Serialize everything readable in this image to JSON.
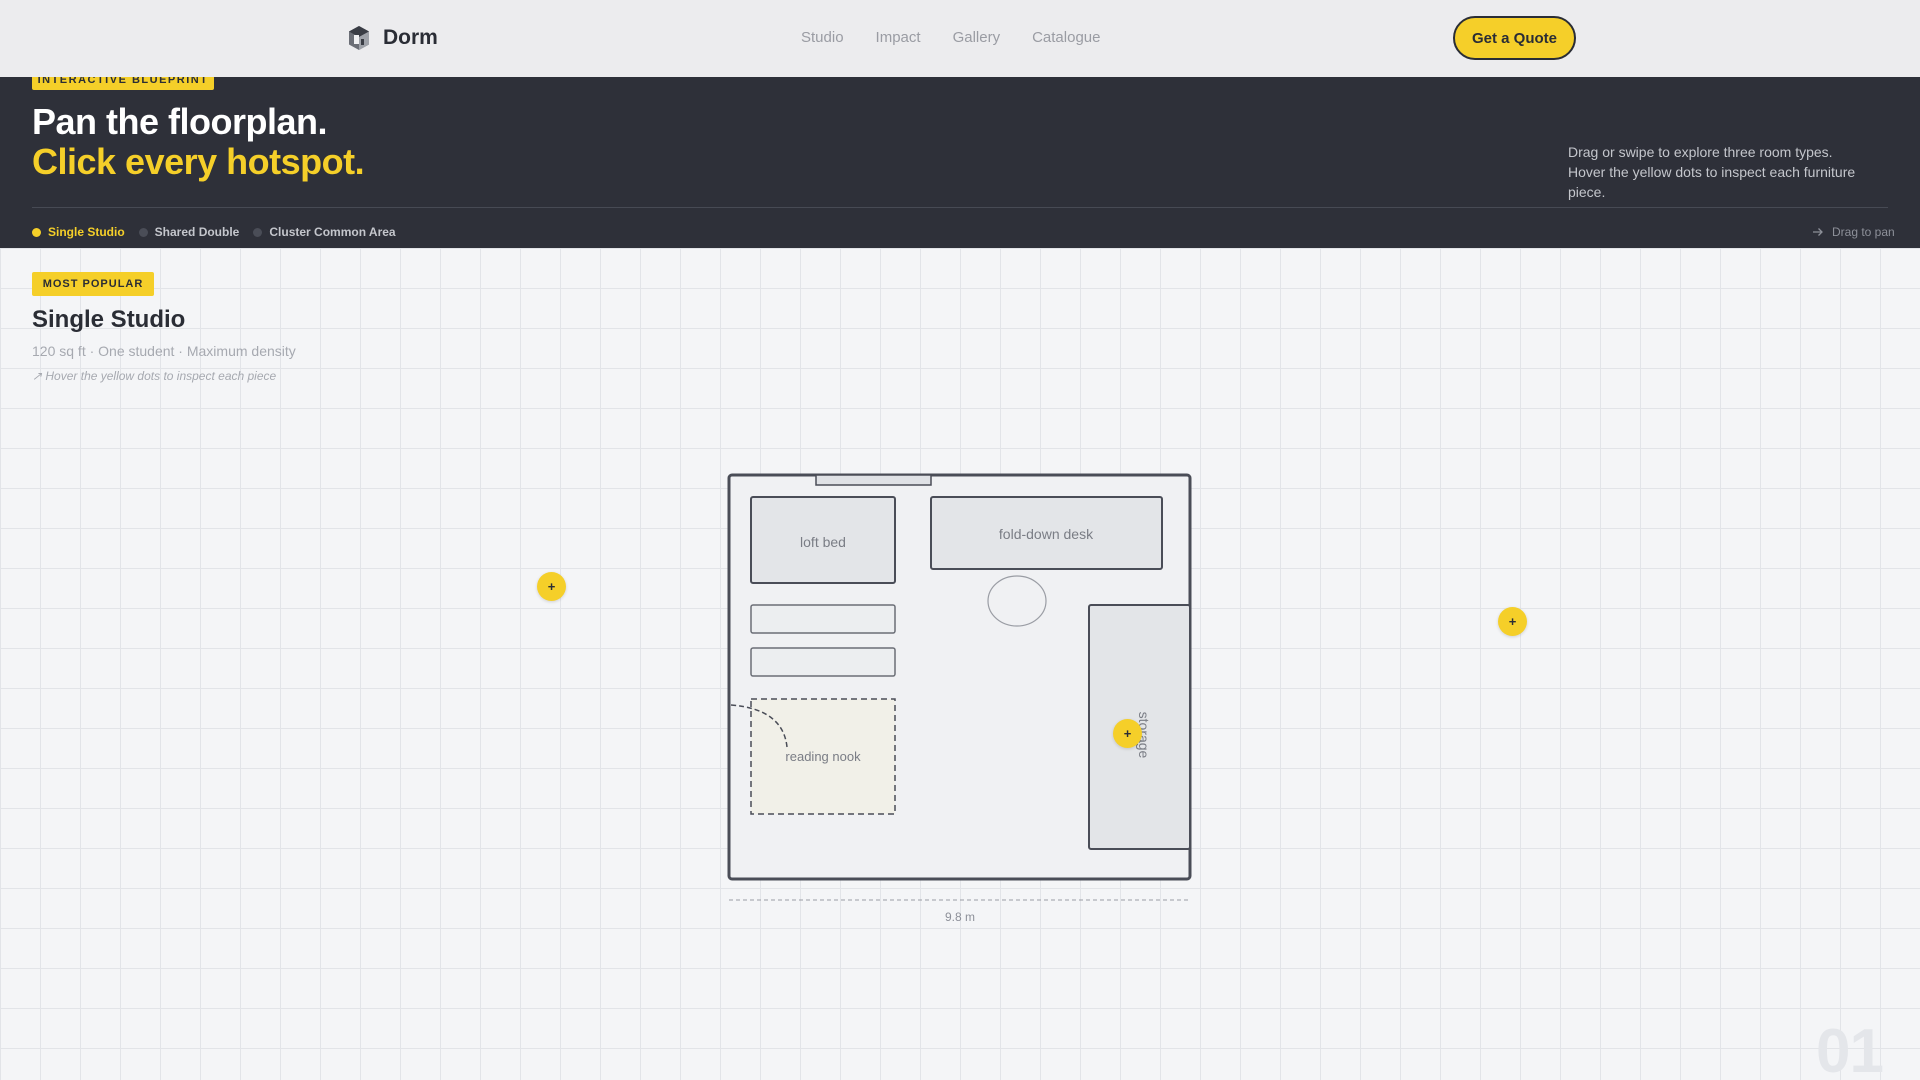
{
  "nav": {
    "brand": "Dorm",
    "links": [
      "Studio",
      "Impact",
      "Gallery",
      "Catalogue"
    ],
    "cta": "Get a Quote"
  },
  "hero": {
    "badge": "INTERACTIVE BLUEPRINT",
    "title": "Pan the floorplan.",
    "subtitle": "Click every hotspot.",
    "description": "Drag or swipe to explore three room types. Hover the yellow dots to inspect each furniture piece.",
    "tabs": [
      {
        "label": "Single Studio",
        "active": true
      },
      {
        "label": "Shared Double",
        "active": false
      },
      {
        "label": "Cluster Common Area",
        "active": false
      }
    ],
    "drag_hint": "Drag to pan"
  },
  "room": {
    "badge": "MOST POPULAR",
    "title": "Single Studio",
    "meta": "120 sq ft · One student · Maximum density",
    "hint": "↗ Hover the yellow dots to inspect each piece",
    "number": "01",
    "dimension": "9.8 m",
    "furniture": {
      "loft_bed": "loft bed",
      "desk": "fold-down desk",
      "nook": "reading nook",
      "storage": "storage"
    },
    "hotspot_symbol": "+"
  },
  "colors": {
    "accent": "#f5cf29",
    "dark": "#2e3039",
    "text": "#2a2d35"
  }
}
